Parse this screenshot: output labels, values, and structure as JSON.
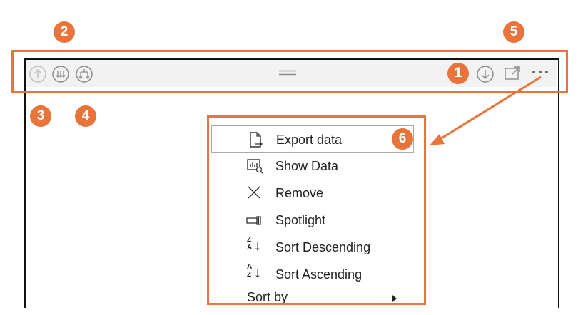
{
  "badges": [
    "1",
    "2",
    "3",
    "4",
    "5",
    "6"
  ],
  "menu": {
    "items": [
      {
        "label": "Export data",
        "icon": "export-icon"
      },
      {
        "label": "Show Data",
        "icon": "show-data-icon"
      },
      {
        "label": "Remove",
        "icon": "remove-icon"
      },
      {
        "label": "Spotlight",
        "icon": "spotlight-icon"
      },
      {
        "label": "Sort Descending",
        "icon": "sort-descending-icon"
      },
      {
        "label": "Sort Ascending",
        "icon": "sort-ascending-icon"
      },
      {
        "label": "Sort by",
        "icon": "submenu-caret-icon"
      }
    ]
  },
  "colors": {
    "highlight": "#e8743b",
    "header": "#f2f2f2",
    "frame": "#111111"
  }
}
